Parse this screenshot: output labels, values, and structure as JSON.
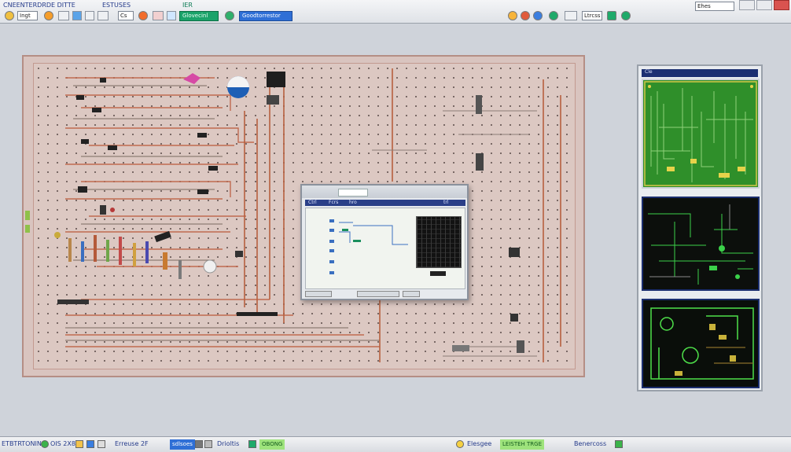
{
  "toolbar": {
    "left_text": "CNEENTERDRDE DITTE",
    "mid_text": "ESTUSES",
    "tab_text": "IER",
    "field1": "Ingt",
    "field2": "Cs",
    "green_btn": "Glovecinl",
    "blue_btn": "Goodtorrestor",
    "right_label": "Ehes",
    "right_field": "Ltrcss"
  },
  "board": {
    "label": ""
  },
  "dialog": {
    "title": "",
    "menu_items": [
      "Ctrl",
      "Fcrs",
      "hro",
      "trl"
    ]
  },
  "right_panel": {
    "header": "Cle"
  },
  "bottombar": {
    "left_text": "ETBTRTONIN",
    "mid_text": "OIS 2X8",
    "field_text": "Erreuse 2F",
    "blue_text": "sdlsoes",
    "center_text": "Drioltis",
    "green_text": "OBONG",
    "right_text": "Elesgee",
    "right_green": "LEISTEH TRGE",
    "far_right": "Benercoss"
  },
  "colors": {
    "board": "#dcc8c2",
    "pcb_green": "#2f8f2a",
    "pcb_dark": "#0c0f0c",
    "accent_blue": "#2f6fd6"
  }
}
